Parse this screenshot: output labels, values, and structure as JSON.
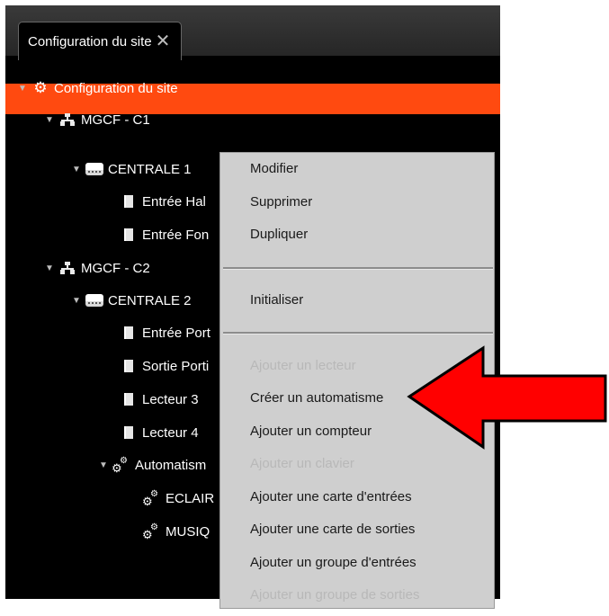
{
  "window": {
    "tab_title": "Configuration du site",
    "close_glyph": "✕"
  },
  "tree": {
    "root": {
      "label": "Configuration du site",
      "icon": "gear-icon"
    },
    "nodes": [
      {
        "label": "MGCF - C1",
        "icon": "network-icon"
      },
      {
        "label": "CENTRALE 1",
        "icon": "device-icon",
        "selected": true
      },
      {
        "label": "Entrée Hal",
        "icon": "document-icon"
      },
      {
        "label": "Entrée Fon",
        "icon": "document-icon"
      },
      {
        "label": "MGCF - C2",
        "icon": "network-icon"
      },
      {
        "label": "CENTRALE 2",
        "icon": "device-icon"
      },
      {
        "label": "Entrée Port",
        "icon": "document-icon"
      },
      {
        "label": "Sortie Porti",
        "icon": "document-icon"
      },
      {
        "label": "Lecteur 3",
        "icon": "document-icon"
      },
      {
        "label": "Lecteur 4",
        "icon": "document-icon"
      },
      {
        "label": "Automatism",
        "icon": "gears-icon"
      },
      {
        "label": "ECLAIR",
        "icon": "gears-icon"
      },
      {
        "label": "MUSIQ",
        "icon": "gears-icon"
      }
    ]
  },
  "context_menu": {
    "items": [
      {
        "label": "Modifier",
        "enabled": true
      },
      {
        "label": "Supprimer",
        "enabled": true
      },
      {
        "label": "Dupliquer",
        "enabled": true
      },
      {
        "label": "Initialiser",
        "enabled": true
      },
      {
        "label": "Ajouter un lecteur",
        "enabled": false
      },
      {
        "label": "Créer un automatisme",
        "enabled": true
      },
      {
        "label": "Ajouter un compteur",
        "enabled": true
      },
      {
        "label": "Ajouter un clavier",
        "enabled": false
      },
      {
        "label": "Ajouter une carte d'entrées",
        "enabled": true
      },
      {
        "label": "Ajouter une carte de sorties",
        "enabled": true
      },
      {
        "label": "Ajouter un groupe d'entrées",
        "enabled": true
      },
      {
        "label": "Ajouter un groupe de sorties",
        "enabled": false
      }
    ]
  },
  "colors": {
    "selection": "#ff4a10",
    "background": "#000000",
    "menu_background": "#cfcfcf",
    "annotation_arrow": "#ff0000"
  }
}
